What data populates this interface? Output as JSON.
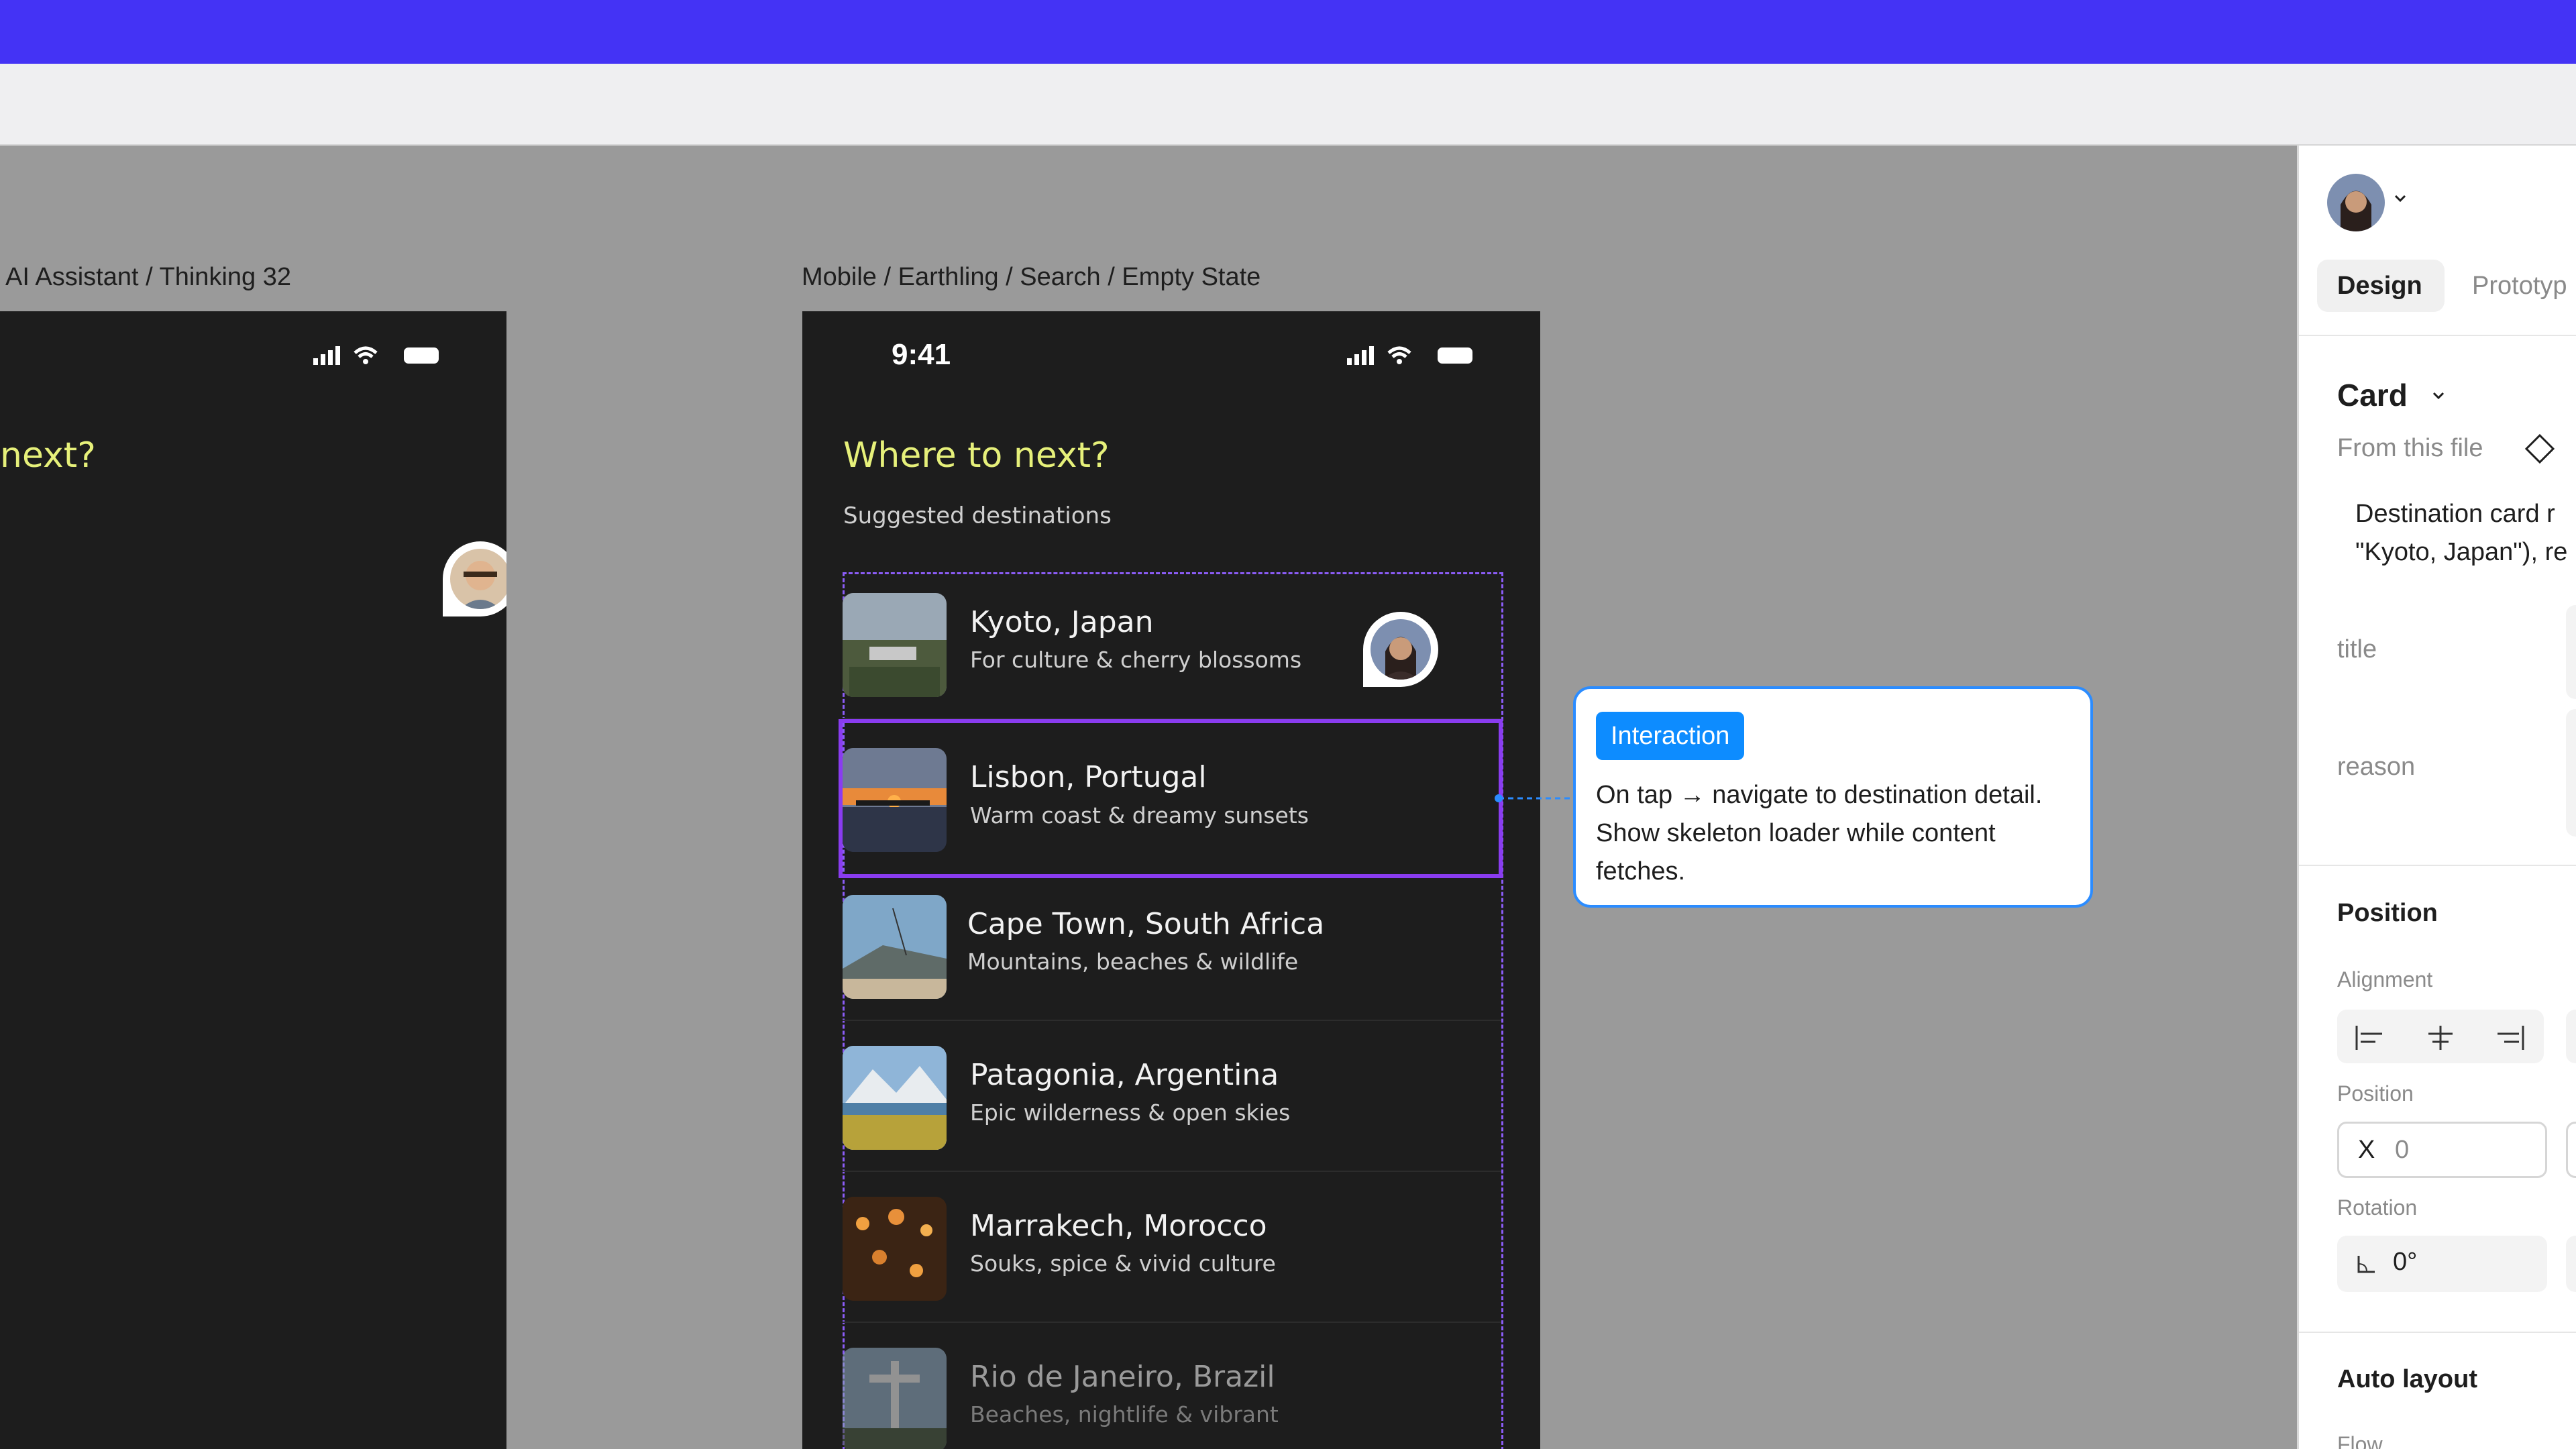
{
  "canvas": {
    "frames": [
      {
        "label": "AI Assistant / Thinking 32",
        "heading": "next?"
      },
      {
        "label": "Mobile / Earthling / Search / Empty State",
        "time": "9:41",
        "heading": "Where to next?",
        "subheading": "Suggested destinations"
      }
    ],
    "destinations": [
      {
        "title": "Kyoto, Japan",
        "subtitle": "For culture & cherry blossoms",
        "selected": false
      },
      {
        "title": "Lisbon, Portugal",
        "subtitle": "Warm coast & dreamy sunsets",
        "selected": true
      },
      {
        "title": "Cape Town, South Africa",
        "subtitle": "Mountains, beaches & wildlife",
        "selected": false
      },
      {
        "title": "Patagonia, Argentina",
        "subtitle": "Epic wilderness & open skies",
        "selected": false
      },
      {
        "title": "Marrakech, Morocco",
        "subtitle": "Souks, spice & vivid culture",
        "selected": false
      },
      {
        "title": "Rio de Janeiro, Brazil",
        "subtitle": "Beaches, nightlife & vibrant",
        "selected": false
      }
    ],
    "note": {
      "tag": "Interaction",
      "text": "On tap → navigate to destination detail. Show skeleton loader while content fetches."
    }
  },
  "panel": {
    "tabs": [
      "Design",
      "Prototyp"
    ],
    "component": {
      "name": "Card",
      "source": "From this file",
      "description_line1": "Destination card r",
      "description_line2": "\"Kyoto, Japan\"), re"
    },
    "props": [
      {
        "label": "title"
      },
      {
        "label": "reason"
      }
    ],
    "position": {
      "section_title": "Position",
      "alignment_label": "Alignment",
      "position_label": "Position",
      "x_label": "X",
      "x_value": "0",
      "rotation_label": "Rotation",
      "rotation_value": "0°"
    },
    "auto_layout": {
      "title": "Auto layout",
      "flow_label": "Flow"
    }
  },
  "colors": {
    "accent": "#4433f5",
    "heading": "#e6f07a",
    "selection": "#8a3cf0",
    "note_border": "#2b8cff"
  }
}
